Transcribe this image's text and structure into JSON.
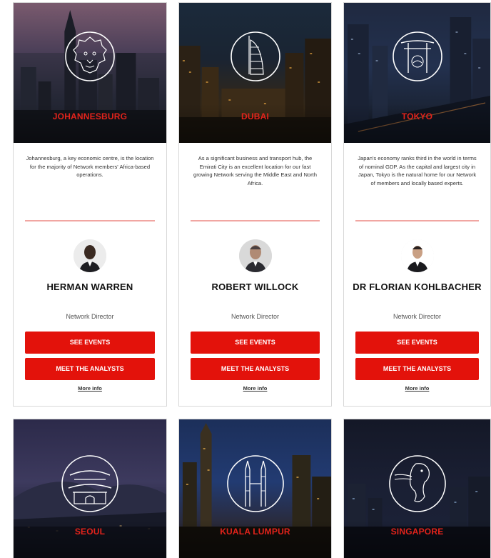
{
  "cards": [
    {
      "city": "JOHANNESBURG",
      "description": "Johannesburg, a key economic centre, is the location for the majority of Network members' Africa-based operations.",
      "person": "HERMAN WARREN",
      "role": "Network Director",
      "see_events": "SEE EVENTS",
      "meet_analysts": "MEET THE ANALYSTS",
      "more_info": "More info",
      "emblem_icon": "lion-emblem-icon"
    },
    {
      "city": "DUBAI",
      "description": "As a significant business and transport hub, the Emirati City is an excellent location for our fast growing Network serving the Middle East and North Africa.",
      "person": "ROBERT WILLOCK",
      "role": "Network Director",
      "see_events": "SEE EVENTS",
      "meet_analysts": "MEET THE ANALYSTS",
      "more_info": "More info",
      "emblem_icon": "burj-al-arab-emblem-icon"
    },
    {
      "city": "TOKYO",
      "description": "Japan's economy ranks third in the world in terms of nominal GDP. As the capital and largest city in Japan, Tokyo is the natural home for our Network of members and locally based experts.",
      "person": "DR FLORIAN KOHLBACHER",
      "role": "Network Director",
      "see_events": "SEE EVENTS",
      "meet_analysts": "MEET THE ANALYSTS",
      "more_info": "More info",
      "emblem_icon": "torii-gate-emblem-icon"
    }
  ],
  "bottom_cards": [
    {
      "city": "SEOUL",
      "emblem_icon": "gate-pavilion-emblem-icon"
    },
    {
      "city": "KUALA LUMPUR",
      "emblem_icon": "petronas-towers-emblem-icon"
    },
    {
      "city": "SINGAPORE",
      "emblem_icon": "merlion-emblem-icon"
    }
  ],
  "colors": {
    "accent": "#e3120b",
    "divider": "#f1a6a2",
    "city_label": "#e3231b"
  }
}
